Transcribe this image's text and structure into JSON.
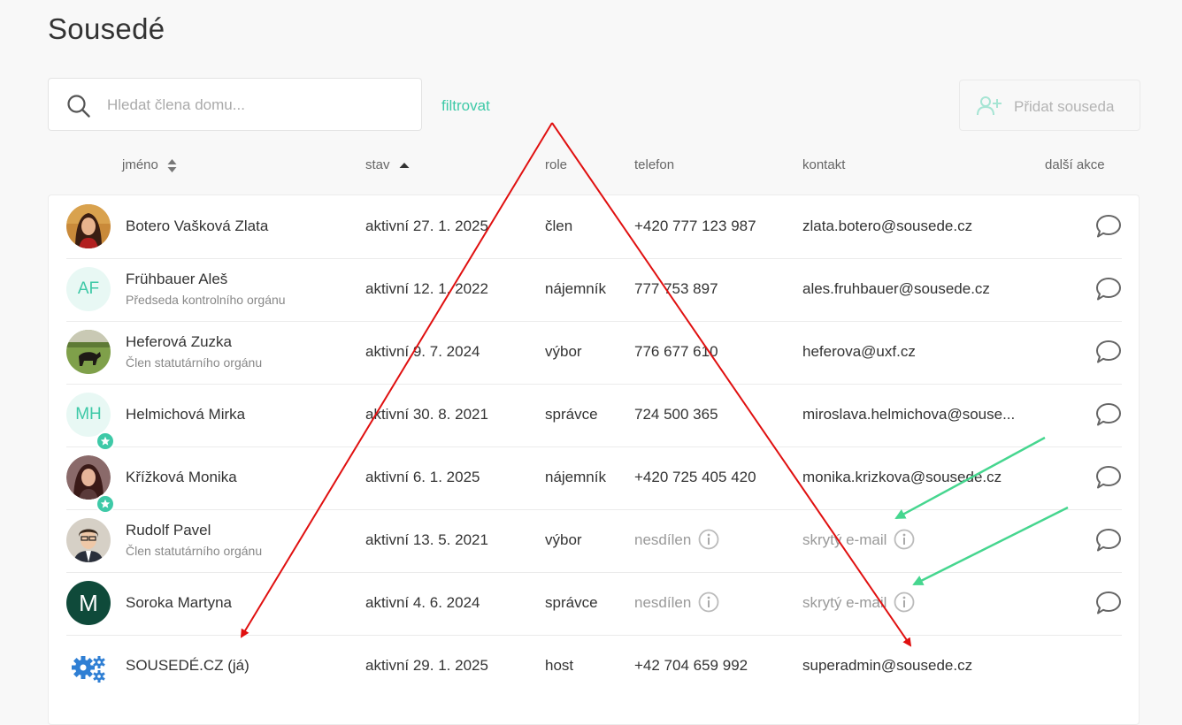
{
  "page": {
    "title": "Sousedé"
  },
  "search": {
    "placeholder": "Hledat člena domu..."
  },
  "filter_label": "filtrovat",
  "add_neighbor_label": "Přidat souseda",
  "columns": {
    "name": "jméno",
    "status": "stav",
    "role": "role",
    "phone": "telefon",
    "contact": "kontakt",
    "actions": "další akce"
  },
  "members": [
    {
      "name": "Botero Vašková Zlata",
      "subtitle": "",
      "status": "aktivní 27. 1. 2025",
      "role": "člen",
      "phone": "+420 777 123 987",
      "contact": "zlata.botero@sousede.cz",
      "avatar": "photo-woman"
    },
    {
      "name": "Frühbauer Aleš",
      "subtitle": "Předseda kontrolního orgánu",
      "status": "aktivní 12. 1. 2022",
      "role": "nájemník",
      "phone": "777 753 897",
      "contact": "ales.fruhbauer@sousede.cz",
      "initials": "AF"
    },
    {
      "name": "Heferová Zuzka",
      "subtitle": "Člen statutárního orgánu",
      "status": "aktivní 9. 7. 2024",
      "role": "výbor",
      "phone": "776 677 610",
      "contact": "heferova@uxf.cz",
      "avatar": "photo-dog"
    },
    {
      "name": "Helmichová Mirka",
      "subtitle": "",
      "status": "aktivní 30. 8. 2021",
      "role": "správce",
      "phone": "724 500 365",
      "contact": "miroslava.helmichova@souse...",
      "initials": "MH",
      "badge": "star-icon"
    },
    {
      "name": "Křížková Monika",
      "subtitle": "",
      "status": "aktivní 6. 1. 2025",
      "role": "nájemník",
      "phone": "+420 725 405 420",
      "contact": "monika.krizkova@sousede.cz",
      "avatar": "photo-woman-2",
      "badge": "star-icon"
    },
    {
      "name": "Rudolf Pavel",
      "subtitle": "Člen statutárního orgánu",
      "status": "aktivní 13. 5. 2021",
      "role": "výbor",
      "phone": "nesdílen",
      "contact": "skrytý e-mail",
      "avatar": "photo-man"
    },
    {
      "name": "Soroka Martyna",
      "subtitle": "",
      "status": "aktivní 4. 6. 2024",
      "role": "správce",
      "phone": "nesdílen",
      "contact": "skrytý e-mail",
      "initials": "M"
    },
    {
      "name": "SOUSEDÉ.CZ (já)",
      "subtitle": "",
      "status": "aktivní 29. 1. 2025",
      "role": "host",
      "phone": "+42 704 659 992",
      "contact": "superadmin@sousede.cz",
      "avatar": "gears-icon"
    }
  ],
  "colors": {
    "accent": "#3ec9a7",
    "annotation_red": "#e01010",
    "annotation_green": "#46d68f"
  }
}
